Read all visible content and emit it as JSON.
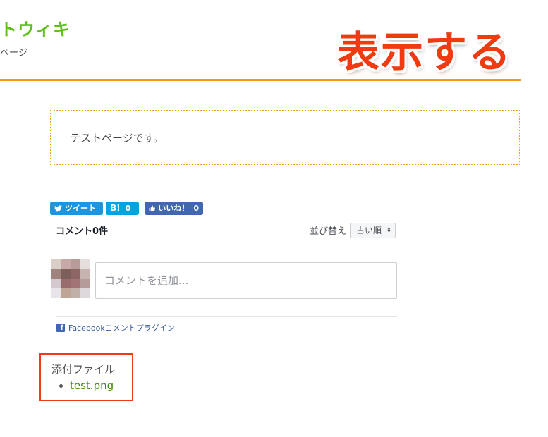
{
  "header": {
    "site_title": "トウィキ",
    "subtitle": "ページ"
  },
  "overlay": {
    "label": "表示する",
    "color": "#f03a12"
  },
  "content": {
    "text": "テストページです。"
  },
  "share": {
    "tweet_label": "ツイート",
    "hatena_label": "B!",
    "hatena_count": "0",
    "like_label": "いいね！",
    "like_count": "0"
  },
  "comments": {
    "count_label": "コメント0件",
    "sort_label": "並び替え",
    "sort_selected": "古い順",
    "input_placeholder": "コメントを追加...",
    "plugin_label": "Facebookコメントプラグイン",
    "avatar_colors": [
      "#d9cfc8",
      "#c8a8a8",
      "#b89b9b",
      "#e6dedd",
      "#a0837c",
      "#7d5f5a",
      "#8e6565",
      "#c7b3b0",
      "#d3c9cf",
      "#9a6b6b",
      "#a17575",
      "#b49c9a",
      "#e8e4ea",
      "#bfa595",
      "#c0b0a8",
      "#ddd8dc"
    ]
  },
  "attachments": {
    "title": "添付ファイル",
    "files": [
      "test.png"
    ]
  },
  "colors": {
    "accent_orange": "#f39c12",
    "title_green": "#5fbf1a",
    "link_green": "#3e8e0c",
    "twitter_blue": "#1b95e0",
    "hatena_blue": "#00a4de",
    "facebook_blue": "#4267b2"
  }
}
